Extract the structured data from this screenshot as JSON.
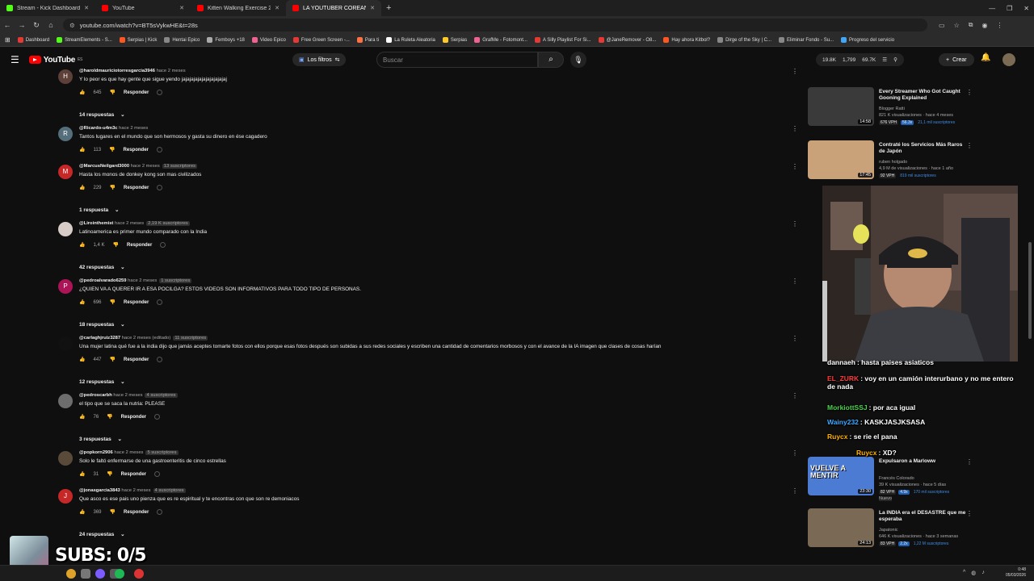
{
  "browser": {
    "tabs": [
      {
        "label": "Stream - Kick Dashboard",
        "color": "#53fc18",
        "active": false
      },
      {
        "label": "YouTube",
        "color": "#ff0000",
        "active": false
      },
      {
        "label": "Kitten Walking Exercise 2 - You",
        "color": "#ff0000",
        "active": false
      },
      {
        "label": "LA YOUTUBER COREANA que",
        "color": "#ff0000",
        "active": true
      }
    ],
    "url": "youtube.com/watch?v=BT5sVykwHE&t=28s",
    "bookmarks": [
      "Dashboard",
      "StreamElements - S...",
      "Serpias | Kick",
      "Hentai Epico",
      "Femboys +18",
      "Video Epico",
      "Free Green Screen -...",
      "Para ti",
      "La Ruleta Aleatoria",
      "Serpias",
      "GrafMe - Fotomont...",
      "A Silly Playlist For Si...",
      "@JaneRemover - O8...",
      "Hay ahora Kitbol?",
      "Dirge of the Sky | C...",
      "Eliminar Fondo - Su...",
      "Progreso del servicio"
    ]
  },
  "header": {
    "logo": "YouTube",
    "logo_sup": "ES",
    "filters": "Los filtros",
    "search_placeholder": "Buscar",
    "stats": [
      "19.8K",
      "1,799",
      "69.7K"
    ],
    "create": "Crear"
  },
  "comments": [
    {
      "avatar": "H",
      "color": "#5d4037",
      "handle": "@haroldmauriciotorresgarcia3946",
      "time": "hace 2 meses",
      "sub": "",
      "text": "Y lo peor es que hay gente que sigue yendo jajajajajajajajajajajaj",
      "likes": "645",
      "replies": "14 respuestas"
    },
    {
      "avatar": "R",
      "color": "#546e7a",
      "handle": "@Ricardo-u4m3c",
      "time": "hace 2 meses",
      "sub": "",
      "text": "Tantos lugares en el mundo que son hermosos y gasta su dinero en ése cagadero",
      "likes": "113",
      "replies": ""
    },
    {
      "avatar": "M",
      "color": "#c62828",
      "handle": "@MarcusNeilgard3000",
      "time": "hace 2 meses",
      "sub": "13 suscriptores",
      "text": "Hasta los monos de donkey kong son mas civilizados",
      "likes": "229",
      "replies": "1 respuesta"
    },
    {
      "avatar": "",
      "color": "#d7ccc8",
      "handle": "@Lirointhemist",
      "time": "hace 2 meses",
      "sub": "2,19 K suscriptores",
      "text": "Latinoamerica es primer mundo comparado con la India",
      "likes": "1,4 K",
      "replies": "42 respuestas"
    },
    {
      "avatar": "P",
      "color": "#ad1457",
      "handle": "@pedroalvarado6259",
      "time": "hace 2 meses",
      "sub": "1 suscriptores",
      "text": "¿QUIEN VA A QUERER IR A ESA POCILGA? ESTOS VIDEOS SON INFORMATIVOS PARA TODO TIPO DE PERSONAS.",
      "likes": "696",
      "replies": "18 respuestas"
    },
    {
      "avatar": "",
      "color": "#111111",
      "handle": "@carlaghjruiz3287",
      "time": "hace 2 meses (editado)",
      "sub": "11 suscriptores",
      "text": "Una mujer latina qué fue a la india dijo que jamás aceptes tomarte fotos con ellos porque esas fotos después son subidas a sus redes sociales y escriben una cantidad de comentarios morbosos y con el avance de la IA imagen que clases de cosas harían",
      "likes": "447",
      "replies": "12 respuestas"
    },
    {
      "avatar": "",
      "color": "#6d6d6d",
      "handle": "@pedroscarbh",
      "time": "hace 2 meses",
      "sub": "4 suscriptores",
      "text": "el tipo que se saca la nutria: PLEASE",
      "likes": "76",
      "replies": "3 respuestas"
    },
    {
      "avatar": "",
      "color": "#5a4a3a",
      "handle": "@popkorn2906",
      "time": "hace 2 meses",
      "sub": "5 suscriptores",
      "text": "Solo le faltó enfermarse de una gastroenteritis de cinco estrellas",
      "likes": "31",
      "replies": ""
    },
    {
      "avatar": "J",
      "color": "#c62828",
      "handle": "@jonasgarcia3843",
      "time": "hace 2 meses",
      "sub": "4 suscriptores",
      "text": "Que asco es ese pais uno pienza que es re espiritual y te encontras con que son re demoniacos",
      "likes": "369",
      "replies": "24 respuestas"
    }
  ],
  "reply_label": "Responder",
  "sidebar": [
    {
      "title": "Every Streamer Who Got Caught Gooning Explained",
      "channel": "Blogger Ratti",
      "meta": "821 K visualizaciones · hace 4 meses",
      "duration": "14:58",
      "badges": [
        "676 VPH",
        "56.3x"
      ],
      "subs": "21,1 mil suscriptores",
      "thumb": "#3a3a3a"
    },
    {
      "title": "Contraté los Servicios Más Raros de Japón",
      "channel": "ruben holgado",
      "meta": "4,9 M de visualizaciones · hace 1 año",
      "duration": "17:45",
      "badges": [
        "92 VPH"
      ],
      "subs": "819 mil suscriptores",
      "thumb": "#c9a27a"
    },
    {
      "title": "Expulsaron a Marloww",
      "channel": "Francés Colorado",
      "meta": "39 K visualizaciones · hace 5 días",
      "duration": "23:30",
      "badges": [
        "82 VPH",
        "4.9x"
      ],
      "subs": "170 mil suscriptores",
      "thumb": "#4b7bd3",
      "extra": "Nuevo",
      "thumb_text": "VUELVE A MENTIR"
    },
    {
      "title": "La INDIA era el DESASTRE que me esperaba",
      "channel": "Japatonic",
      "meta": "646 K visualizaciones · hace 3 semanas",
      "duration": "24:13",
      "badges": [
        "83 VPH",
        "2.2x"
      ],
      "subs": "1,22 M suscriptores",
      "thumb": "#7a6a55"
    }
  ],
  "chat": [
    {
      "user": "dannaeh",
      "msg": "hasta paises asiaticos",
      "color": "#ffffff"
    },
    {
      "user": "EL_ZURK",
      "msg": "voy en un camión interurbano y no me entero de nada",
      "color": "#ff3b3b"
    },
    {
      "user": "MorkiottSSJ",
      "msg": "por aca igual",
      "color": "#4fd14f"
    },
    {
      "user": "Wainy232",
      "msg": "KASKJASJKSASA",
      "color": "#3fa9ff"
    },
    {
      "user": "Ruycx",
      "msg": "se rie el pana",
      "color": "#ffb300"
    },
    {
      "user": "Ruycx",
      "msg": "XD?",
      "color": "#ffb300"
    }
  ],
  "overlay": {
    "subs": "SUBS: 0/5"
  },
  "taskbar": {
    "time": "0:48",
    "date": "05/03/2026"
  }
}
